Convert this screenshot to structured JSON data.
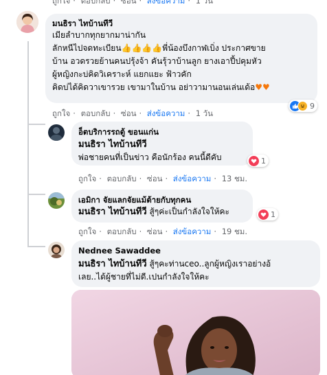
{
  "common": {
    "like": "ถูกใจ",
    "reply": "ตอบกลับ",
    "hide": "ซ่อน",
    "share": "ส่งข้อความ",
    "sep": "·"
  },
  "top_actions": {
    "time": "1 วัน"
  },
  "main_comment": {
    "author": "มนธิรา ไทบ้านทีวี",
    "line1": "เมียลำบากทุกยากมาน่ากัน",
    "line2a": "ลักหนีไปจดทะเบียน",
    "line2b": "พี่น้องบึงกาฬเบิ่ง ประกาศขาย",
    "line3": "บ้าน อวดรวยย้านคนปรุ้งจ้า คันรุ้วาบ้านลูก ยางเอาปี้ปคุมหัว",
    "line4": "ผู้หญิงกะบ่คิดวิเคราะห์ แยกแยะ ฟ้าวคัก",
    "line5": "คิดบ่ได้คิดวาเขารวย เขามาในบ้าน อย่าวามานอนเล่นเด้อ",
    "reaction_count": "9",
    "time": "1 วัน"
  },
  "replies": [
    {
      "author": "อ็ตบริการรถตู้ ขอนแก่น",
      "mention": "มนธิรา ไทบ้านทีวี",
      "text": "พ่อชายคนที่เป็นข่าว คือนักร้อง คนนี้ดีคับ",
      "reaction_count": "1",
      "time": "13 ชม."
    },
    {
      "author": "เอมิกา จัยแลกจัยแม้ต้ายกับทุกคน",
      "mention": "มนธิรา ไทบ้านทีวี",
      "text": "สู้ๆค่ะเป็นกำลังใจให้คะ",
      "reaction_count": "1",
      "time": "19 ชม."
    },
    {
      "author": "Nednee Sawaddee",
      "mention": "มนธิรา ไทบ้านทีวี",
      "text1": "สู้ๆคะท่านceo..ลูกผู้หญิงเราอย่างอ้",
      "text2": "เลย..ได้ผู้ชายที่ไม่ดี.เปนกำลังใจให้คะ"
    }
  ],
  "colors": {
    "bubble": "#f0f2f5",
    "link": "#1877f2",
    "meta": "#65676b",
    "love": "#f33e58",
    "like": "#1877f2",
    "haha": "#f7b125"
  },
  "icons": [
    "thumbs-up-emoji",
    "orange-heart-emoji",
    "like-reaction",
    "haha-reaction",
    "love-reaction"
  ]
}
